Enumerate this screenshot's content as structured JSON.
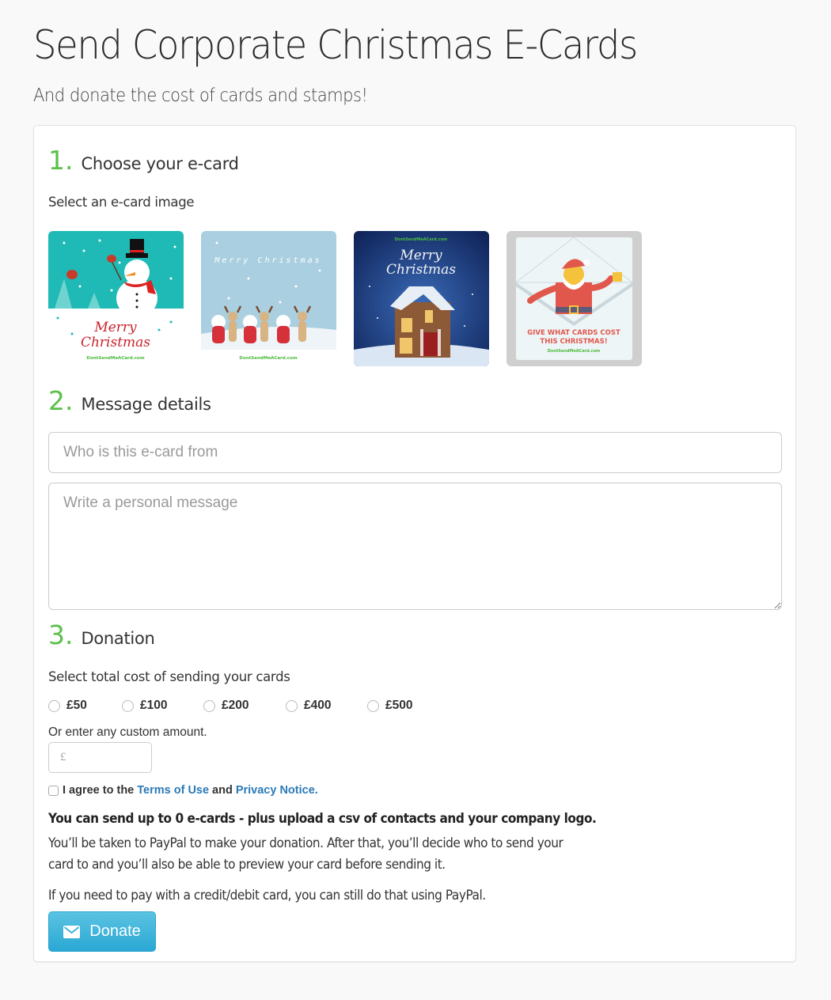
{
  "header": {
    "title": "Send Corporate Christmas E-Cards",
    "subtitle": "And donate the cost of cards and stamps!"
  },
  "steps": [
    {
      "number": "1.",
      "label": "Choose your e-card"
    },
    {
      "number": "2.",
      "label": "Message details"
    },
    {
      "number": "3.",
      "label": "Donation"
    }
  ],
  "ecards": {
    "label": "Select an e-card image",
    "options": [
      {
        "name": "snowman",
        "title": "Merry Christmas",
        "footer": "DontSendMeACard.com",
        "bg": "#1fbab5"
      },
      {
        "name": "santas-reindeer",
        "title": "Merry Christmas",
        "footer": "DontSendMeACard.com",
        "bg": "#a9cfe0"
      },
      {
        "name": "snowy-house",
        "title": "Merry Christmas",
        "footer": "DontSendMeACard.com",
        "bg": "#1b3a78"
      },
      {
        "name": "santa-envelope",
        "title": "GIVE WHAT CARDS COST THIS CHRISTMAS!",
        "title_line1": "GIVE WHAT CARDS COST",
        "title_line2": "THIS CHRISTMAS!",
        "footer": "DontSendMeACard.com",
        "bg": "#cfcfcf"
      }
    ]
  },
  "message": {
    "from_placeholder": "Who is this e-card from",
    "from_value": "",
    "message_placeholder": "Write a personal message",
    "message_value": ""
  },
  "donation": {
    "label": "Select total cost of sending your cards",
    "options": [
      "£50",
      "£100",
      "£200",
      "£400",
      "£500"
    ],
    "selected": null,
    "custom_label": "Or enter any custom amount.",
    "custom_placeholder": "£",
    "custom_value": ""
  },
  "agreement": {
    "prefix": "I agree to the",
    "terms_link": "Terms of Use",
    "and": "and",
    "privacy_link": "Privacy Notice.",
    "checked": false
  },
  "info": {
    "bold_note": "You can send up to 0 e-cards - plus upload a csv of contacts and your company logo.",
    "paypal_note": "You’ll be taken to PayPal to make your donation. After that, you’ll decide who to send your card to and you’ll also be able to preview your card before sending it.",
    "card_note": "If you need to pay with a credit/debit card, you can still do that using PayPal."
  },
  "actions": {
    "donate_label": "Donate",
    "donate_icon": "envelope-icon"
  },
  "colors": {
    "step_number": "#5cc04a",
    "link": "#2a7ab8",
    "donate_button": "#2aa8d4"
  }
}
